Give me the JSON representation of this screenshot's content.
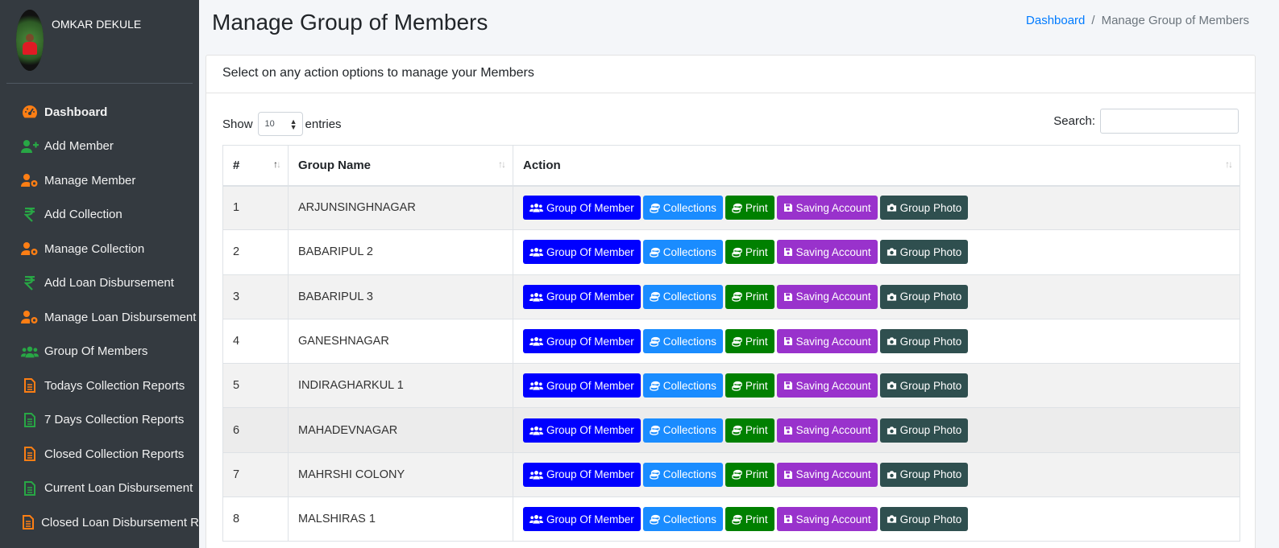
{
  "user": {
    "name": "OMKAR DEKULE"
  },
  "sidebar": {
    "items": [
      {
        "label": "Dashboard",
        "icon": "dashboard-icon",
        "color": "#fd7e14",
        "bold": true
      },
      {
        "label": "Add Member",
        "icon": "user-plus-icon",
        "color": "#28a745"
      },
      {
        "label": "Manage Member",
        "icon": "user-cog-icon",
        "color": "#fd7e14"
      },
      {
        "label": "Add Collection",
        "icon": "rupee-icon",
        "color": "#28a745"
      },
      {
        "label": "Manage Collection",
        "icon": "user-cog-icon",
        "color": "#fd7e14"
      },
      {
        "label": "Add Loan Disbursement",
        "icon": "rupee-icon",
        "color": "#28a745"
      },
      {
        "label": "Manage Loan Disbursement",
        "icon": "user-cog-icon",
        "color": "#fd7e14"
      },
      {
        "label": "Group Of Members",
        "icon": "users-icon",
        "color": "#28a745"
      },
      {
        "label": "Todays Collection Reports",
        "icon": "file-icon",
        "color": "#fd7e14"
      },
      {
        "label": "7 Days Collection Reports",
        "icon": "file-icon",
        "color": "#28a745"
      },
      {
        "label": "Closed Collection Reports",
        "icon": "file-icon",
        "color": "#fd7e14"
      },
      {
        "label": "Current Loan Disbursement",
        "icon": "file-icon",
        "color": "#28a745"
      },
      {
        "label": "Closed Loan Disbursement R",
        "icon": "file-icon",
        "color": "#fd7e14"
      }
    ]
  },
  "header": {
    "title": "Manage Group of Members",
    "breadcrumb": {
      "home": "Dashboard",
      "sep": "/",
      "current": "Manage Group of Members"
    }
  },
  "card": {
    "subtitle": "Select on any action options to manage your Members"
  },
  "controls": {
    "show_label": "Show",
    "entries_value": "10",
    "entries_label": "entries",
    "search_label": "Search:",
    "search_value": ""
  },
  "table": {
    "headers": [
      "#",
      "Group Name",
      "Action"
    ],
    "actions": {
      "group": "Group Of Member",
      "collections": "Collections",
      "print": "Print",
      "saving": "Saving Account",
      "photo": "Group Photo"
    },
    "rows": [
      {
        "num": "1",
        "name": "ARJUNSINGHNAGAR"
      },
      {
        "num": "2",
        "name": "BABARIPUL 2"
      },
      {
        "num": "3",
        "name": "BABARIPUL 3"
      },
      {
        "num": "4",
        "name": "GANESHNAGAR"
      },
      {
        "num": "5",
        "name": "INDIRAGHARKUL 1"
      },
      {
        "num": "6",
        "name": "MAHADEVNAGAR"
      },
      {
        "num": "7",
        "name": "MAHRSHI COLONY"
      },
      {
        "num": "8",
        "name": "MALSHIRAS 1"
      }
    ]
  },
  "colors": {
    "group_btn": "#0000ff",
    "collections_btn": "#1a8cff",
    "print_btn": "#008000",
    "saving_btn": "#9932cc",
    "photo_btn": "#2f4f4f",
    "sidebar_bg": "#343a40",
    "link": "#007bff"
  }
}
